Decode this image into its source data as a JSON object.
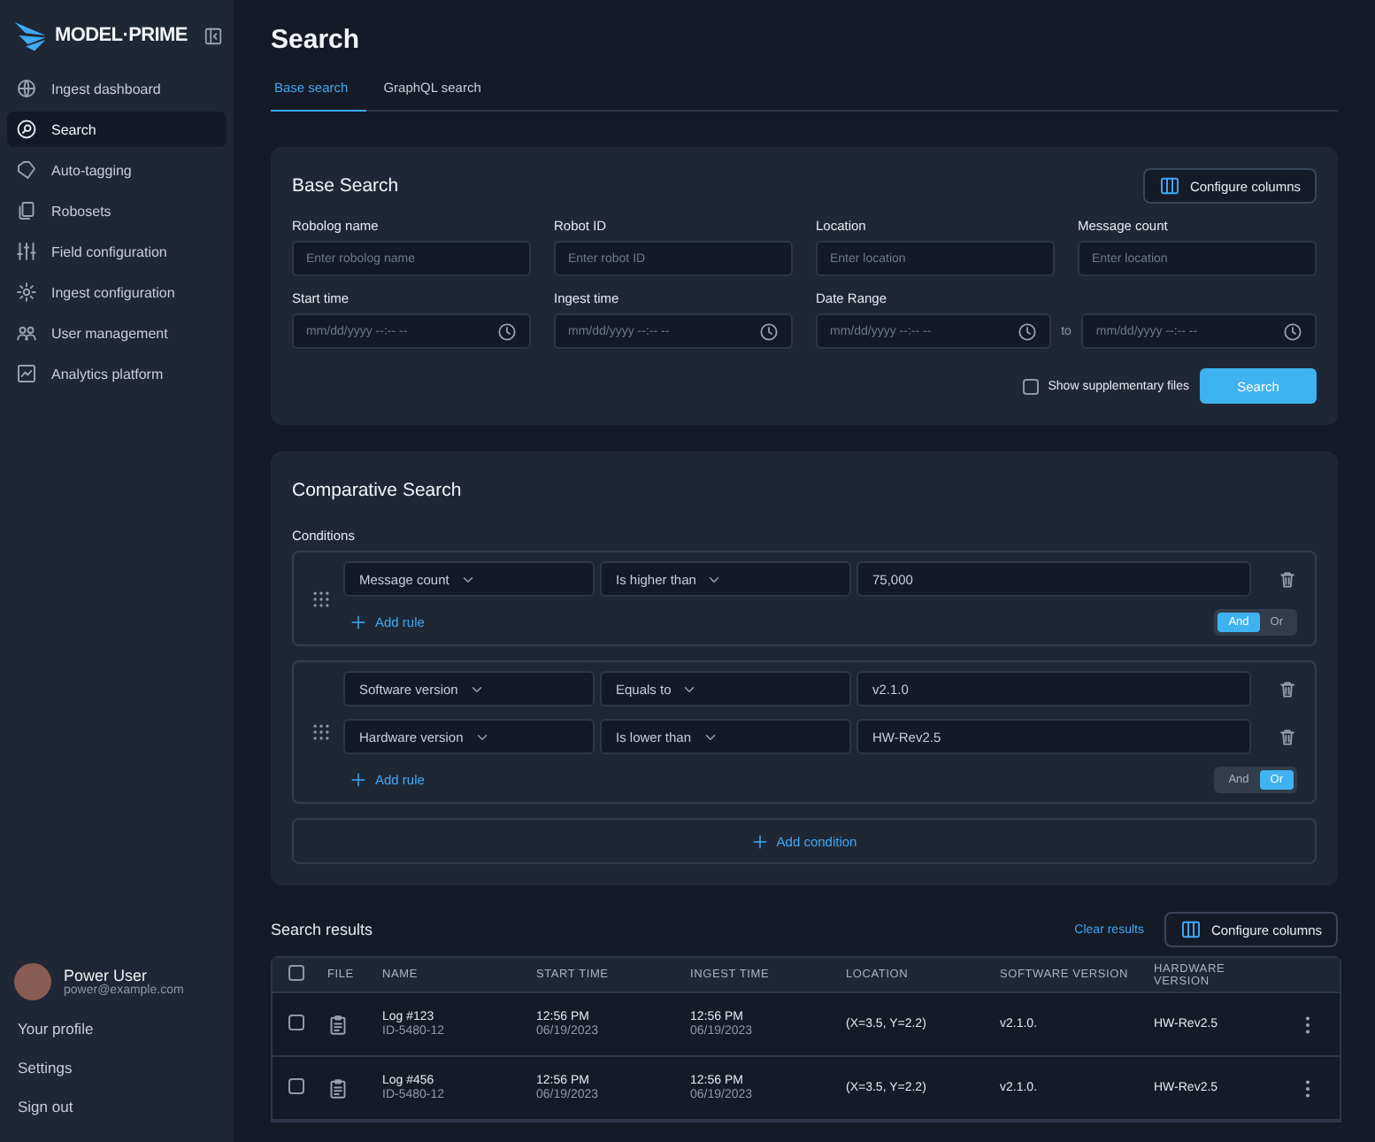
{
  "brand": {
    "name": "MODEL·PRIME"
  },
  "sidebar": {
    "items": [
      {
        "label": "Ingest dashboard",
        "selected": false
      },
      {
        "label": "Search",
        "selected": true
      },
      {
        "label": "Auto-tagging",
        "selected": false
      },
      {
        "label": "Robosets",
        "selected": false
      },
      {
        "label": "Field configuration",
        "selected": false
      },
      {
        "label": "Ingest configuration",
        "selected": false
      },
      {
        "label": "User management",
        "selected": false
      },
      {
        "label": "Analytics platform",
        "selected": false
      }
    ],
    "user": {
      "name": "Power User",
      "email": "power@example.com"
    },
    "links": [
      "Your profile",
      "Settings",
      "Sign out"
    ]
  },
  "page": {
    "title": "Search"
  },
  "tabs": [
    {
      "label": "Base search",
      "selected": true
    },
    {
      "label": "GraphQL search",
      "selected": false
    }
  ],
  "base_search": {
    "title": "Base Search",
    "configure_button": "Configure columns",
    "fields": [
      {
        "label": "Robolog name",
        "kind": "text",
        "placeholder": "Enter robolog name"
      },
      {
        "label": "Robot ID",
        "kind": "text",
        "placeholder": "Enter robot ID"
      },
      {
        "label": "Location",
        "kind": "text",
        "placeholder": "Enter location"
      },
      {
        "label": "Message count",
        "kind": "text",
        "placeholder": "Enter location"
      },
      {
        "label": "Start time",
        "kind": "datetime",
        "placeholder": "mm/dd/yyyy  --:-- --"
      },
      {
        "label": "Ingest time",
        "kind": "datetime",
        "placeholder": "mm/dd/yyyy  --:-- --"
      },
      {
        "label": "Date Range",
        "kind": "range",
        "placeholder": "mm/dd/yyyy  --:-- --",
        "separator": "to",
        "placeholder_end": "mm/dd/yyyy  --:-- --"
      }
    ],
    "supplementary": {
      "label": "Show supplementary files",
      "checked": false
    },
    "search_button": "Search"
  },
  "comparative_search": {
    "title": "Comparative Search",
    "conditions_label": "Conditions",
    "conditions": [
      {
        "rules": [
          {
            "field": "Message count",
            "operator": "Is higher than",
            "value": "75,000"
          }
        ],
        "add_rule": "Add rule",
        "logic": [
          {
            "label": "And",
            "selected": true
          },
          {
            "label": "Or",
            "selected": false
          }
        ]
      },
      {
        "rules": [
          {
            "field": "Software version",
            "operator": "Equals to",
            "value": "v2.1.0"
          },
          {
            "field": "Hardware version",
            "operator": "Is lower than",
            "value": "HW-Rev2.5"
          }
        ],
        "add_rule": "Add rule",
        "logic": [
          {
            "label": "And",
            "selected": false
          },
          {
            "label": "Or",
            "selected": true
          }
        ]
      }
    ],
    "add_condition": "Add condition"
  },
  "results": {
    "title": "Search results",
    "clear_link": "Clear results",
    "configure_button": "Configure columns",
    "select_all_checked": false,
    "columns": [
      "FILE",
      "NAME",
      "START TIME",
      "INGEST TIME",
      "LOCATION",
      "SOFTWARE VERSION",
      "HARDWARE VERSION"
    ],
    "rows": [
      {
        "checked": false,
        "name": "Log #123",
        "id": "ID-5480-12",
        "start_time": "12:56 PM",
        "start_date": "06/19/2023",
        "ingest_time": "12:56 PM",
        "ingest_date": "06/19/2023",
        "location": "(X=3.5, Y=2.2)",
        "software_version": "v2.1.0.",
        "hardware_version": "HW-Rev2.5"
      },
      {
        "checked": false,
        "name": "Log #456",
        "id": "ID-5480-12",
        "start_time": "12:56 PM",
        "start_date": "06/19/2023",
        "ingest_time": "12:56 PM",
        "ingest_date": "06/19/2023",
        "location": "(X=3.5, Y=2.2)",
        "software_version": "v2.1.0.",
        "hardware_version": "HW-Rev2.5"
      }
    ]
  }
}
